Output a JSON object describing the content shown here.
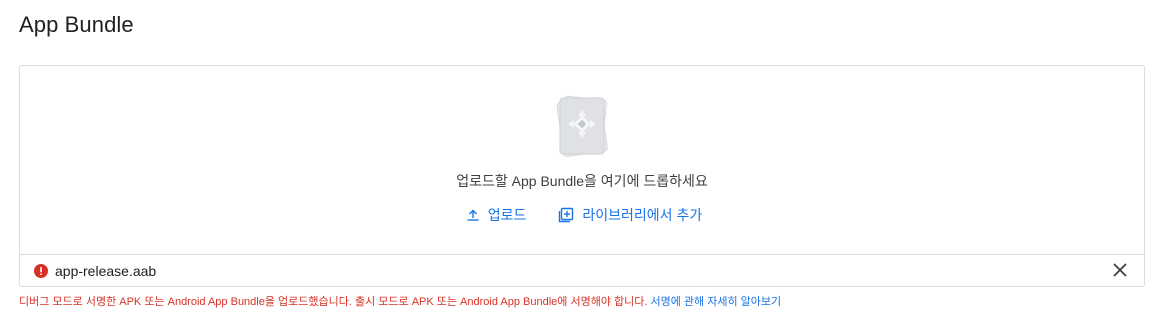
{
  "page": {
    "title": "App Bundle"
  },
  "dropzone": {
    "illustration_icon": "app-bundle-illustration",
    "instruction": "업로드할 App Bundle을 여기에 드롭하세요",
    "upload_label": "업로드",
    "upload_icon": "upload-icon",
    "library_label": "라이브러리에서 추가",
    "library_icon": "add-to-library-icon"
  },
  "file": {
    "name": "app-release.aab",
    "status_icon": "error-icon",
    "remove_icon": "close-icon"
  },
  "error": {
    "message": "디버그 모드로 서명한 APK 또는 Android App Bundle을 업로드했습니다. 출시 모드로 APK 또는 Android App Bundle에 서명해야 합니다.",
    "link_text": "서명에 관해 자세히 알아보기"
  },
  "colors": {
    "accent": "#1a73e8",
    "error": "#d93025",
    "border": "#dadce0"
  }
}
